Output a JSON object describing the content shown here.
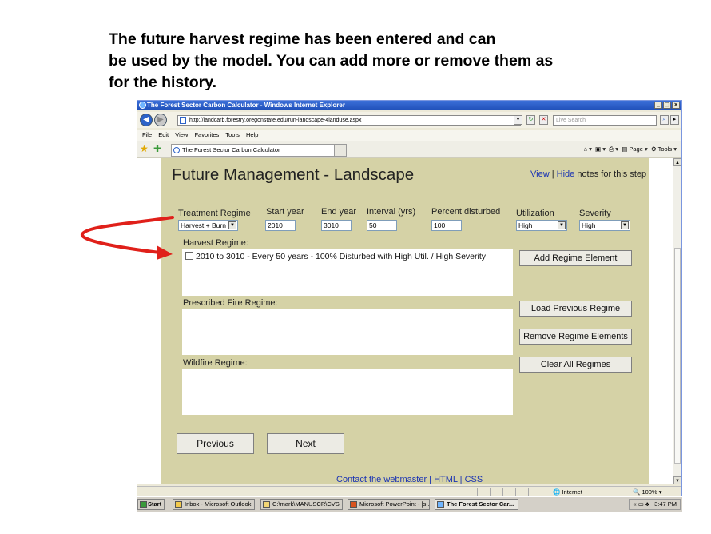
{
  "slide": {
    "heading_lines": [
      "The future harvest regime has been entered and can",
      "be used by the model. You can add more or remove them as",
      "for the history."
    ]
  },
  "browser": {
    "title": "The Forest Sector Carbon Calculator - Windows Internet Explorer",
    "url": "http://landcarb.forestry.oregonstate.edu/run-landscape-4landuse.aspx",
    "search_placeholder": "Live Search",
    "menu": [
      "File",
      "Edit",
      "View",
      "Favorites",
      "Tools",
      "Help"
    ],
    "tab_title": "The Forest Sector Carbon Calculator",
    "cmd_page": "Page",
    "cmd_tools": "Tools",
    "status_zone": "Internet",
    "zoom": "100%"
  },
  "page": {
    "title": "Future Management - Landscape",
    "view_link": "View",
    "separator": " | ",
    "hide_link": "Hide",
    "notes_text": " notes for this step",
    "fields": {
      "treatment_regime": {
        "label": "Treatment Regime",
        "value": "Harvest + Burn"
      },
      "start_year": {
        "label": "Start year",
        "value": "2010"
      },
      "end_year": {
        "label": "End year",
        "value": "3010"
      },
      "interval": {
        "label": "Interval (yrs)",
        "value": "50"
      },
      "percent_disturbed": {
        "label": "Percent disturbed",
        "value": "100"
      },
      "utilization": {
        "label": "Utilization",
        "value": "High"
      },
      "severity": {
        "label": "Severity",
        "value": "High"
      }
    },
    "harvest_label": "Harvest Regime:",
    "harvest_entries": [
      "2010 to 3010 - Every 50 years - 100% Disturbed with High Util. / High Severity"
    ],
    "prescribed_label": "Prescribed Fire Regime:",
    "wildfire_label": "Wildfire Regime:",
    "buttons": {
      "add": "Add Regime Element",
      "load": "Load Previous Regime",
      "remove": "Remove Regime Elements",
      "clear": "Clear All Regimes",
      "previous": "Previous",
      "next": "Next"
    },
    "footer": "Contact the webmaster | HTML | CSS"
  },
  "taskbar": {
    "start": "Start",
    "items": [
      "Inbox - Microsoft Outlook",
      "C:\\mark\\MANUSCR\\CVS",
      "Microsoft PowerPoint - [s...",
      "The Forest Sector Car..."
    ],
    "clock": "3:47 PM"
  },
  "colors": {
    "panel": "#d5d2a6",
    "arrow": "#e0201a",
    "link": "#1a33b3"
  }
}
